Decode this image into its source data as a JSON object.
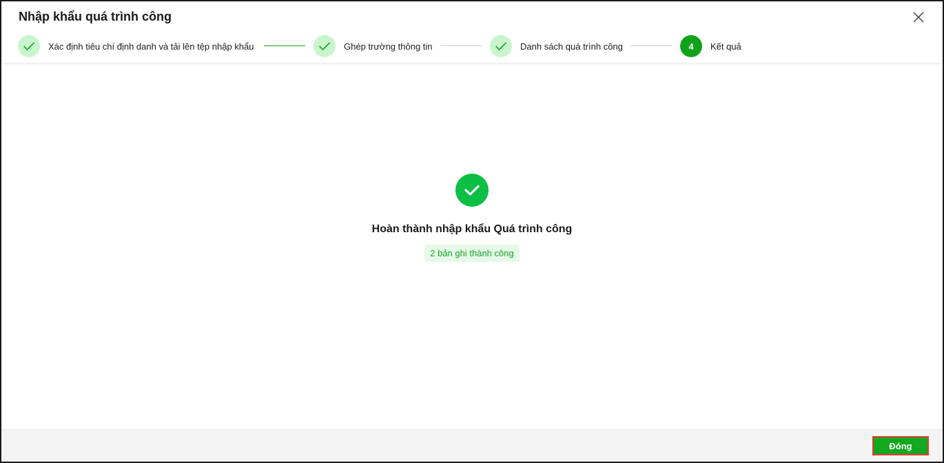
{
  "dialog": {
    "title": "Nhập khẩu quá trình công",
    "close_icon": "close-icon"
  },
  "steps": [
    {
      "label": "Xác định tiêu chí định danh và tải lên tệp nhập khẩu",
      "status": "done",
      "icon": "check-icon"
    },
    {
      "label": "Ghép trường thông tin",
      "status": "done",
      "icon": "check-icon"
    },
    {
      "label": "Danh sách quá trình công",
      "status": "done",
      "icon": "check-icon"
    },
    {
      "label": "Kết quả",
      "status": "active",
      "number": "4"
    }
  ],
  "result": {
    "icon": "success-check-icon",
    "title": "Hoàn thành nhập khẩu Quá trình công",
    "badge": "2 bản ghi thành công"
  },
  "footer": {
    "close_label": "Đóng"
  },
  "colors": {
    "accent": "#12a81f",
    "success": "#0bbf45",
    "step_done_bg": "#c9f5cd"
  }
}
